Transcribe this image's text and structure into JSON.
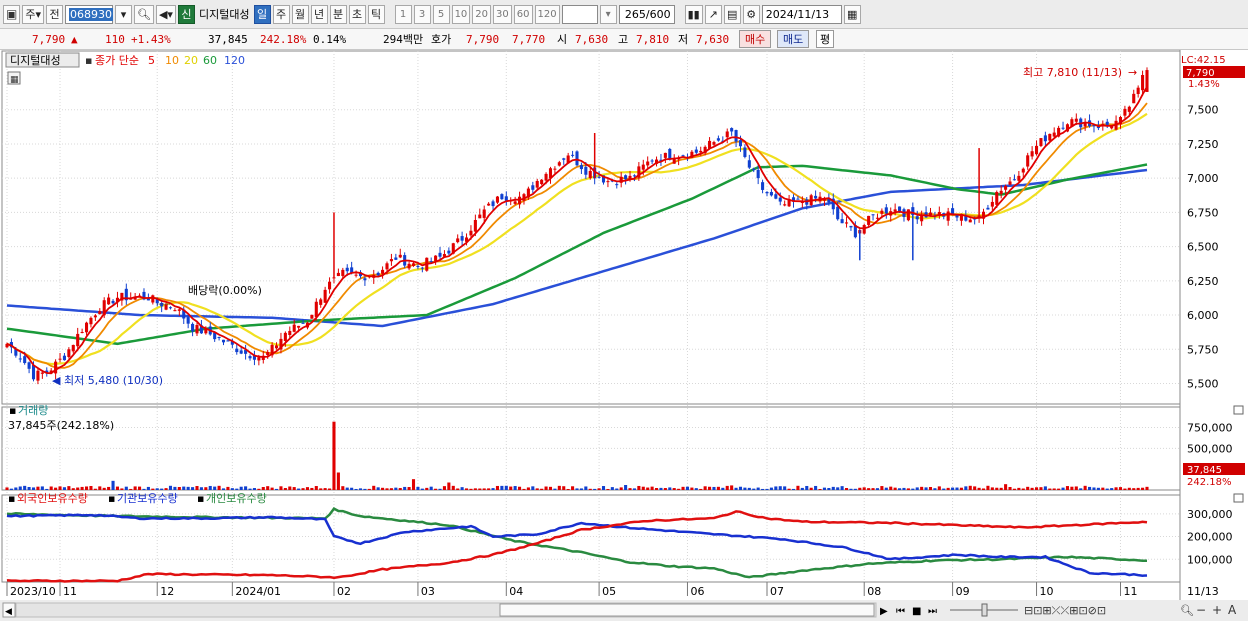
{
  "toolbar": {
    "period_select": "주",
    "prev_label": "전",
    "stock_code": "068930",
    "new_badge": "신",
    "stock_name": "디지털대성",
    "period_tabs": [
      "일",
      "주",
      "월",
      "년",
      "분",
      "초",
      "틱"
    ],
    "minute_options": [
      "1",
      "3",
      "5",
      "10",
      "20",
      "30",
      "60",
      "120"
    ],
    "count_value": "265",
    "count_total": "/600",
    "date_value": "2024/11/13"
  },
  "quote": {
    "price": "7,790",
    "change": "110",
    "change_pct": "+1.43%",
    "volume": "37,845",
    "volume_ratio": "242.18%",
    "turnover": "0.14%",
    "amount": "294백만",
    "hoga_label": "호가",
    "ask": "7,790",
    "bid": "7,770",
    "open_label": "시",
    "open": "7,630",
    "high_label": "고",
    "high": "7,810",
    "low_label": "저",
    "low": "7,630",
    "buy_button": "매수",
    "sell_button": "매도",
    "eval_button": "평"
  },
  "colors": {
    "up": "#e00000",
    "down": "#1040d0",
    "ma5": "#e00000",
    "ma10": "#f08a00",
    "ma20": "#f0e020",
    "ma60": "#1a9a3a",
    "ma120": "#2a50d8",
    "foreign": "#e01010",
    "institution": "#1830d0",
    "individual": "#2a8a40"
  },
  "chart_data": [
    {
      "type": "candlestick",
      "title": "디지털대성",
      "legend": {
        "prefix": "종가 단순",
        "periods": [
          "5",
          "10",
          "20",
          "60",
          "120"
        ]
      },
      "ylim": [
        5350,
        7900
      ],
      "yticks": [
        "7,500",
        "7,250",
        "7,000",
        "6,750",
        "6,500",
        "6,250",
        "6,000",
        "5,750",
        "5,500"
      ],
      "ytick_values": [
        7500,
        7250,
        7000,
        6750,
        6500,
        6250,
        6000,
        5750,
        5500
      ],
      "lc_label": "LC:42.15",
      "last_price_label": "7,790",
      "last_pct_label": "1.43%",
      "annotations": {
        "high": "최고 7,810 (11/13)",
        "low": "최저 5,480 (10/30)",
        "dividend": "배당락(0.00%)"
      },
      "anchors": [
        [
          0,
          5790
        ],
        [
          3,
          5700
        ],
        [
          6,
          5560
        ],
        [
          9,
          5580
        ],
        [
          13,
          5700
        ],
        [
          17,
          5900
        ],
        [
          21,
          6060
        ],
        [
          25,
          6130
        ],
        [
          28,
          6130
        ],
        [
          32,
          6130
        ],
        [
          34,
          6090
        ],
        [
          38,
          6060
        ],
        [
          42,
          5910
        ],
        [
          46,
          5860
        ],
        [
          50,
          5790
        ],
        [
          54,
          5720
        ],
        [
          58,
          5690
        ],
        [
          60,
          5750
        ],
        [
          63,
          5870
        ],
        [
          68,
          5960
        ],
        [
          72,
          6200
        ],
        [
          76,
          6300
        ],
        [
          80,
          6280
        ],
        [
          84,
          6310
        ],
        [
          88,
          6420
        ],
        [
          93,
          6360
        ],
        [
          98,
          6420
        ],
        [
          103,
          6560
        ],
        [
          108,
          6760
        ],
        [
          112,
          6870
        ],
        [
          117,
          6860
        ],
        [
          121,
          7020
        ],
        [
          127,
          7180
        ],
        [
          131,
          7060
        ],
        [
          136,
          6980
        ],
        [
          141,
          7000
        ],
        [
          146,
          7140
        ],
        [
          151,
          7170
        ],
        [
          156,
          7190
        ],
        [
          161,
          7280
        ],
        [
          164,
          7330
        ],
        [
          168,
          7080
        ],
        [
          171,
          6920
        ],
        [
          175,
          6800
        ],
        [
          180,
          6830
        ],
        [
          185,
          6860
        ],
        [
          188,
          6700
        ],
        [
          192,
          6600
        ],
        [
          196,
          6720
        ],
        [
          200,
          6780
        ],
        [
          205,
          6730
        ],
        [
          210,
          6740
        ],
        [
          215,
          6720
        ],
        [
          220,
          6700
        ],
        [
          224,
          6900
        ],
        [
          228,
          7000
        ],
        [
          232,
          7200
        ],
        [
          236,
          7330
        ],
        [
          240,
          7420
        ],
        [
          244,
          7400
        ],
        [
          248,
          7380
        ],
        [
          252,
          7420
        ],
        [
          256,
          7640
        ],
        [
          257,
          7760
        ],
        [
          258,
          7790
        ]
      ],
      "ma60_anchors": [
        [
          0,
          5900
        ],
        [
          25,
          5790
        ],
        [
          45,
          5900
        ],
        [
          70,
          5960
        ],
        [
          95,
          6000
        ],
        [
          115,
          6270
        ],
        [
          135,
          6600
        ],
        [
          155,
          6850
        ],
        [
          170,
          7080
        ],
        [
          180,
          7090
        ],
        [
          200,
          7020
        ],
        [
          215,
          6920
        ],
        [
          225,
          6880
        ],
        [
          240,
          6990
        ],
        [
          258,
          7100
        ]
      ],
      "ma120_anchors": [
        [
          0,
          6070
        ],
        [
          30,
          6000
        ],
        [
          60,
          5980
        ],
        [
          85,
          5920
        ],
        [
          110,
          6080
        ],
        [
          135,
          6320
        ],
        [
          160,
          6560
        ],
        [
          180,
          6780
        ],
        [
          200,
          6900
        ],
        [
          230,
          6950
        ],
        [
          258,
          7060
        ]
      ]
    },
    {
      "type": "bar",
      "title": "거래량",
      "current_label": "37,845주(242.18%)",
      "yticks": [
        "750,000",
        "500,000"
      ],
      "ytick_values": [
        750000,
        500000
      ],
      "last_value_label": "37,845",
      "last_ratio_label": "242.18%",
      "ylim": [
        0,
        900000
      ],
      "baseline_volume": 30000,
      "spikes": [
        [
          24,
          110000
        ],
        [
          74,
          820000
        ],
        [
          75,
          210000
        ],
        [
          92,
          130000
        ],
        [
          100,
          90000
        ],
        [
          140,
          60000
        ],
        [
          164,
          55000
        ],
        [
          226,
          70000
        ],
        [
          258,
          38000
        ]
      ]
    },
    {
      "type": "line",
      "series_labels": [
        "외국인보유수량",
        "기관보유수량",
        "개인보유수량"
      ],
      "ylim": [
        0,
        330000
      ],
      "yticks": [
        "300,000",
        "200,000",
        "100,000"
      ],
      "ytick_values": [
        300000,
        200000,
        100000
      ],
      "foreign_anchors": [
        [
          0,
          5000
        ],
        [
          25,
          5000
        ],
        [
          32,
          35000
        ],
        [
          60,
          30000
        ],
        [
          75,
          20000
        ],
        [
          85,
          55000
        ],
        [
          100,
          85000
        ],
        [
          110,
          120000
        ],
        [
          120,
          170000
        ],
        [
          130,
          230000
        ],
        [
          145,
          270000
        ],
        [
          160,
          280000
        ],
        [
          165,
          310000
        ],
        [
          172,
          280000
        ],
        [
          180,
          265000
        ],
        [
          200,
          260000
        ],
        [
          215,
          250000
        ],
        [
          230,
          240000
        ],
        [
          258,
          265000
        ]
      ],
      "institution_anchors": [
        [
          0,
          290000
        ],
        [
          20,
          295000
        ],
        [
          30,
          280000
        ],
        [
          45,
          280000
        ],
        [
          60,
          285000
        ],
        [
          72,
          275000
        ],
        [
          74,
          200000
        ],
        [
          80,
          170000
        ],
        [
          90,
          220000
        ],
        [
          105,
          245000
        ],
        [
          110,
          200000
        ],
        [
          120,
          210000
        ],
        [
          130,
          260000
        ],
        [
          140,
          240000
        ],
        [
          160,
          210000
        ],
        [
          175,
          190000
        ],
        [
          190,
          150000
        ],
        [
          200,
          100000
        ],
        [
          215,
          120000
        ],
        [
          225,
          110000
        ],
        [
          235,
          110000
        ],
        [
          245,
          40000
        ],
        [
          258,
          30000
        ]
      ],
      "individual_anchors": [
        [
          0,
          300000
        ],
        [
          25,
          290000
        ],
        [
          45,
          285000
        ],
        [
          72,
          280000
        ],
        [
          74,
          320000
        ],
        [
          80,
          290000
        ],
        [
          100,
          250000
        ],
        [
          115,
          180000
        ],
        [
          130,
          130000
        ],
        [
          140,
          90000
        ],
        [
          150,
          70000
        ],
        [
          160,
          60000
        ],
        [
          168,
          20000
        ],
        [
          180,
          50000
        ],
        [
          195,
          80000
        ],
        [
          210,
          95000
        ],
        [
          225,
          100000
        ],
        [
          240,
          110000
        ],
        [
          258,
          95000
        ]
      ]
    }
  ],
  "xaxis": {
    "labels": [
      {
        "text": "2023/10",
        "i": 0
      },
      {
        "text": "11",
        "i": 12
      },
      {
        "text": "12",
        "i": 34
      },
      {
        "text": "2024/01",
        "i": 51
      },
      {
        "text": "02",
        "i": 74
      },
      {
        "text": "03",
        "i": 93
      },
      {
        "text": "04",
        "i": 113
      },
      {
        "text": "05",
        "i": 134
      },
      {
        "text": "06",
        "i": 154
      },
      {
        "text": "07",
        "i": 172
      },
      {
        "text": "08",
        "i": 194
      },
      {
        "text": "09",
        "i": 214
      },
      {
        "text": "10",
        "i": 233
      },
      {
        "text": "11",
        "i": 252
      }
    ],
    "last_date": "11/13"
  }
}
